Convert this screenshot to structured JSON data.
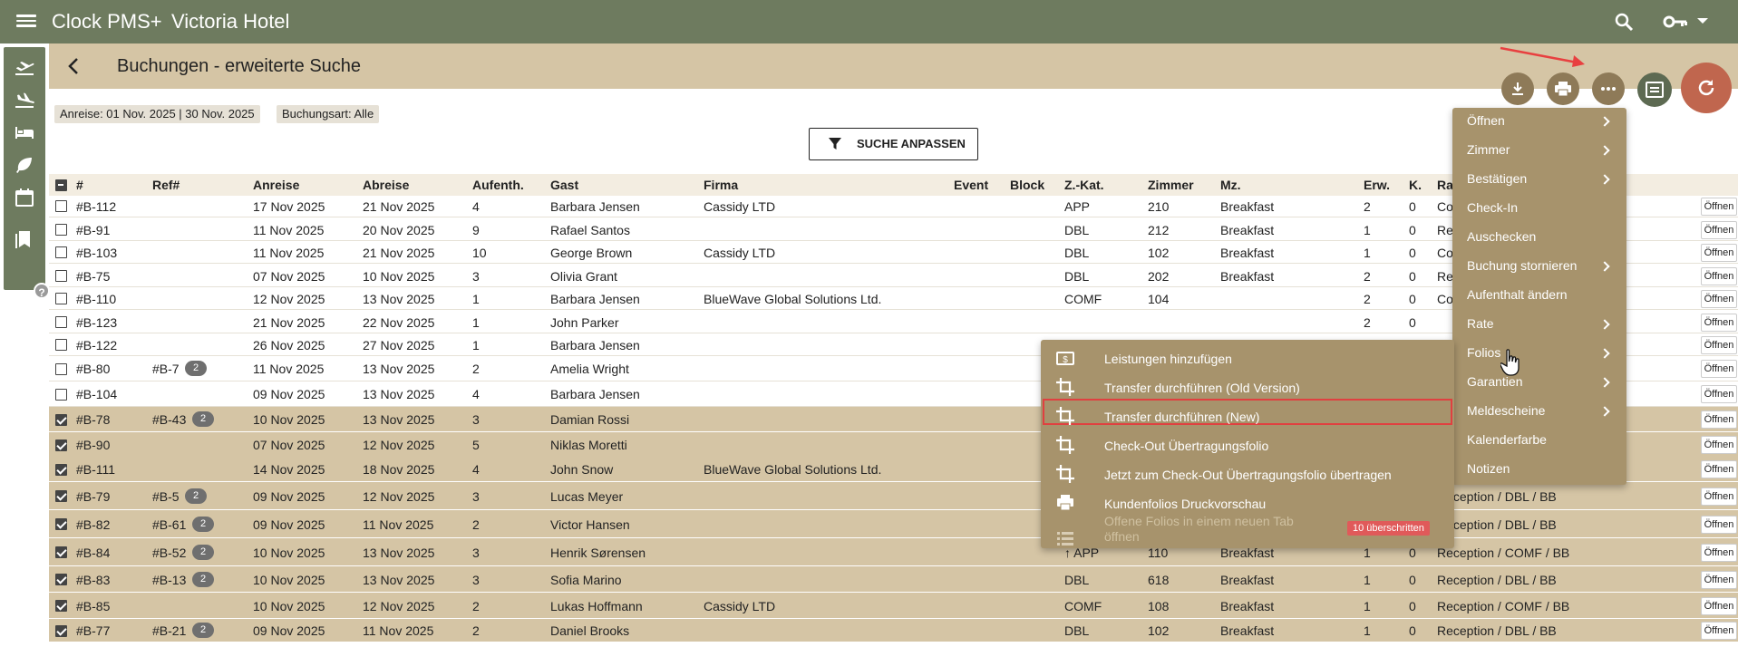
{
  "topbar": {
    "app_name": "Clock PMS+",
    "hotel_name": "Victoria Hotel"
  },
  "page": {
    "title": "Buchungen - erweiterte Suche"
  },
  "filters": {
    "arrival": "Anreise: 01 Nov. 2025 | 30 Nov. 2025",
    "booking_type": "Buchungsart: Alle"
  },
  "filter_button": "SUCHE ANPASSEN",
  "columns": [
    "#",
    "Ref#",
    "Anreise",
    "Abreise",
    "Aufenth.",
    "Gast",
    "Firma",
    "Event",
    "Block",
    "Z.-Kat.",
    "Zimmer",
    "Mz.",
    "Erw.",
    "K.",
    "Ra"
  ],
  "open_label": "Öffnen",
  "rows": [
    {
      "id": "#B-112",
      "ref": "",
      "refcount": "",
      "arr": "17 Nov 2025",
      "dep": "21 Nov 2025",
      "nights": "4",
      "guest": "Barbara Jensen",
      "company": "Cassidy LTD",
      "cat": "APP",
      "room": "210",
      "meal": "Breakfast",
      "adults": "2",
      "kids": "0",
      "rate": "Co",
      "sel": false
    },
    {
      "id": "#B-91",
      "ref": "",
      "refcount": "",
      "arr": "11 Nov 2025",
      "dep": "20 Nov 2025",
      "nights": "9",
      "guest": "Rafael Santos",
      "company": "",
      "cat": "DBL",
      "room": "212",
      "meal": "Breakfast",
      "adults": "1",
      "kids": "0",
      "rate": "Re",
      "sel": false
    },
    {
      "id": "#B-103",
      "ref": "",
      "refcount": "",
      "arr": "11 Nov 2025",
      "dep": "21 Nov 2025",
      "nights": "10",
      "guest": "George Brown",
      "company": "Cassidy LTD",
      "cat": "DBL",
      "room": "102",
      "meal": "Breakfast",
      "adults": "1",
      "kids": "0",
      "rate": "Co",
      "sel": false
    },
    {
      "id": "#B-75",
      "ref": "",
      "refcount": "",
      "arr": "07 Nov 2025",
      "dep": "10 Nov 2025",
      "nights": "3",
      "guest": "Olivia Grant",
      "company": "",
      "cat": "DBL",
      "room": "202",
      "meal": "Breakfast",
      "adults": "2",
      "kids": "0",
      "rate": "Re",
      "sel": false
    },
    {
      "id": "#B-110",
      "ref": "",
      "refcount": "",
      "arr": "12 Nov 2025",
      "dep": "13 Nov 2025",
      "nights": "1",
      "guest": "Barbara Jensen",
      "company": "BlueWave Global Solutions Ltd.",
      "cat": "COMF",
      "room": "104",
      "meal": "",
      "adults": "2",
      "kids": "0",
      "rate": "Co",
      "sel": false
    },
    {
      "id": "#B-123",
      "ref": "",
      "refcount": "",
      "arr": "21 Nov 2025",
      "dep": "22 Nov 2025",
      "nights": "1",
      "guest": "John Parker",
      "company": "",
      "cat": "",
      "room": "",
      "meal": "",
      "adults": "2",
      "kids": "0",
      "rate": "",
      "sel": false
    },
    {
      "id": "#B-122",
      "ref": "",
      "refcount": "",
      "arr": "26 Nov 2025",
      "dep": "27 Nov 2025",
      "nights": "1",
      "guest": "Barbara Jensen",
      "company": "",
      "cat": "",
      "room": "",
      "meal": "",
      "adults": "",
      "kids": "",
      "rate": "",
      "sel": false
    },
    {
      "id": "#B-80",
      "ref": "#B-7",
      "refcount": "2",
      "arr": "11 Nov 2025",
      "dep": "13 Nov 2025",
      "nights": "2",
      "guest": "Amelia Wright",
      "company": "",
      "cat": "",
      "room": "",
      "meal": "",
      "adults": "",
      "kids": "",
      "rate": "",
      "sel": false
    },
    {
      "id": "#B-104",
      "ref": "",
      "refcount": "",
      "arr": "09 Nov 2025",
      "dep": "13 Nov 2025",
      "nights": "4",
      "guest": "Barbara Jensen",
      "company": "",
      "cat": "",
      "room": "",
      "meal": "",
      "adults": "",
      "kids": "",
      "rate": "",
      "sel": false
    },
    {
      "id": "#B-78",
      "ref": "#B-43",
      "refcount": "2",
      "arr": "10 Nov 2025",
      "dep": "13 Nov 2025",
      "nights": "3",
      "guest": "Damian Rossi",
      "company": "",
      "cat": "",
      "room": "",
      "meal": "",
      "adults": "",
      "kids": "",
      "rate": "",
      "sel": true
    },
    {
      "id": "#B-90",
      "ref": "",
      "refcount": "",
      "arr": "07 Nov 2025",
      "dep": "12 Nov 2025",
      "nights": "5",
      "guest": "Niklas Moretti",
      "company": "",
      "cat": "",
      "room": "",
      "meal": "",
      "adults": "",
      "kids": "",
      "rate": "",
      "sel": true
    },
    {
      "id": "#B-111",
      "ref": "",
      "refcount": "",
      "arr": "14 Nov 2025",
      "dep": "18 Nov 2025",
      "nights": "4",
      "guest": "John Snow",
      "company": "BlueWave Global Solutions Ltd.",
      "cat": "",
      "room": "",
      "meal": "",
      "adults": "",
      "kids": "",
      "rate": "",
      "sel": true
    },
    {
      "id": "#B-79",
      "ref": "#B-5",
      "refcount": "2",
      "arr": "09 Nov 2025",
      "dep": "12 Nov 2025",
      "nights": "3",
      "guest": "Lucas Meyer",
      "company": "",
      "cat": "",
      "room": "",
      "meal": "",
      "adults": "",
      "kids": "",
      "rate": "Reception / DBL / BB",
      "sel": true
    },
    {
      "id": "#B-82",
      "ref": "#B-61",
      "refcount": "2",
      "arr": "09 Nov 2025",
      "dep": "11 Nov 2025",
      "nights": "2",
      "guest": "Victor Hansen",
      "company": "",
      "cat": "",
      "room": "",
      "meal": "",
      "adults": "",
      "kids": "",
      "rate": "Reception / DBL / BB",
      "sel": true
    },
    {
      "id": "#B-84",
      "ref": "#B-52",
      "refcount": "2",
      "arr": "10 Nov 2025",
      "dep": "13 Nov 2025",
      "nights": "3",
      "guest": "Henrik Sørensen",
      "company": "",
      "cat": "↑ APP",
      "room": "110",
      "meal": "Breakfast",
      "adults": "1",
      "kids": "0",
      "rate": "Reception / COMF / BB",
      "sel": true
    },
    {
      "id": "#B-83",
      "ref": "#B-13",
      "refcount": "2",
      "arr": "10 Nov 2025",
      "dep": "13 Nov 2025",
      "nights": "3",
      "guest": "Sofia Marino",
      "company": "",
      "cat": "DBL",
      "room": "618",
      "meal": "Breakfast",
      "adults": "1",
      "kids": "0",
      "rate": "Reception / DBL / BB",
      "sel": true
    },
    {
      "id": "#B-85",
      "ref": "",
      "refcount": "",
      "arr": "10 Nov 2025",
      "dep": "12 Nov 2025",
      "nights": "2",
      "guest": "Lukas Hoffmann",
      "company": "Cassidy LTD",
      "cat": "COMF",
      "room": "108",
      "meal": "Breakfast",
      "adults": "1",
      "kids": "0",
      "rate": "Reception / COMF / BB",
      "sel": true
    },
    {
      "id": "#B-77",
      "ref": "#B-21",
      "refcount": "2",
      "arr": "09 Nov 2025",
      "dep": "11 Nov 2025",
      "nights": "2",
      "guest": "Daniel Brooks",
      "company": "",
      "cat": "DBL",
      "room": "102",
      "meal": "Breakfast",
      "adults": "1",
      "kids": "0",
      "rate": "Reception / DBL / BB",
      "sel": true
    }
  ],
  "context_menu": {
    "items": [
      {
        "label": "Öffnen",
        "submenu": true
      },
      {
        "label": "Zimmer",
        "submenu": true
      },
      {
        "label": "Bestätigen",
        "submenu": true
      },
      {
        "label": "Check-In",
        "submenu": false
      },
      {
        "label": "Auschecken",
        "submenu": false
      },
      {
        "label": "Buchung stornieren",
        "submenu": true
      },
      {
        "label": "Aufenthalt ändern",
        "submenu": false
      },
      {
        "label": "Rate",
        "submenu": true
      },
      {
        "label": "Folios",
        "submenu": true
      },
      {
        "label": "Garantien",
        "submenu": true
      },
      {
        "label": "Meldescheine",
        "submenu": true
      },
      {
        "label": "Kalenderfarbe",
        "submenu": false
      },
      {
        "label": "Notizen",
        "submenu": false
      }
    ]
  },
  "folios_submenu": {
    "items": [
      {
        "label": "Leistungen hinzufügen",
        "icon": "money-icon"
      },
      {
        "label": "Transfer durchführen (Old Version)",
        "icon": "crop-icon"
      },
      {
        "label": "Transfer durchführen (New)",
        "icon": "crop-icon"
      },
      {
        "label": "Check-Out Übertragungsfolio",
        "icon": "crop-icon"
      },
      {
        "label": "Jetzt zum Check-Out Übertragungsfolio übertragen",
        "icon": "crop-icon"
      },
      {
        "label": "Kundenfolios Druckvorschau",
        "icon": "print-icon"
      },
      {
        "label": "Offene Folios in einem neuen Tab öffnen",
        "icon": "list-icon"
      }
    ],
    "exceeded_badge": "10 überschritten"
  },
  "colors": {
    "topbar": "#6e7b5f",
    "header": "#d5c5a5",
    "menu": "#a7936c",
    "refresh": "#c0664e",
    "highlight": "#e04040"
  }
}
